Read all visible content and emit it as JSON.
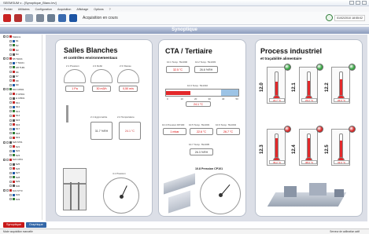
{
  "window": {
    "title": "SEEMSUM v - [Synoptique_Blanc.lev]"
  },
  "menu": [
    "Fichier",
    "Utilitaires",
    "Configuration",
    "Acquisition",
    "Affichage",
    "Options",
    "?"
  ],
  "toolbar": {
    "status": "Acquisition en cours",
    "datetime": "01/02/2010 18:55:02"
  },
  "header": {
    "title": "Synoptique"
  },
  "tree": [
    "Stations",
    "N1",
    "N2",
    "N3",
    "N4",
    "N5 TH101",
    "T TH101",
    "HR TH01",
    "N6",
    "N7",
    "N8",
    "N9",
    "N10 CP301",
    "P CP301",
    "H CP301",
    "N11",
    "N12",
    "N13",
    "N14",
    "N15",
    "N16",
    "N17",
    "N18",
    "N19",
    "N20 ST01",
    "N21",
    "N22",
    "N23",
    "N24 CP01",
    "N25",
    "N26",
    "N27",
    "N28",
    "N29",
    "N30",
    "N31 ST73",
    "N32",
    "N33"
  ],
  "panels": {
    "salles": {
      "title": "Salles Blanches",
      "subtitle": "et contrôles environnementaux",
      "labels": [
        "2.1 Pression",
        "2.2 Débit",
        "2.3 Vitesse",
        "2.1 Hygrométrie",
        "2.2 Température",
        "4.1 Pression"
      ],
      "values": [
        "1 Pa",
        "30 m3/h",
        "0,50 m/s",
        "31.7 %RH",
        "24.1 °C"
      ]
    },
    "cta": {
      "title": "CTA / Tertiaire",
      "labels": [
        "10.1 Temp. TE1000",
        "10.2 Temp. TE1003",
        "10.3 Temp. TE1010",
        "10.4 Pression DP100",
        "10.5 Temp. TE1003",
        "10.6 Temp. TE1004",
        "10.7 Temp. TE1005",
        "10.8 Pression CP101"
      ],
      "values": [
        "32.5 °C",
        "26.6 %RH",
        "24.1 °C",
        "1 mbar",
        "22.6 °C",
        "26.7 °C",
        "26.3 %RH"
      ],
      "bar_ticks": [
        "0",
        "10",
        "20",
        "30",
        "40",
        "50"
      ],
      "bar_level": 0.48
    },
    "process": {
      "title": "Process industriel",
      "subtitle": "et traçabilité alimentaire",
      "thermos": [
        {
          "name": "12.0",
          "value": "22.7 °C",
          "level": 0.6,
          "led": "#3aa845"
        },
        {
          "name": "12.1",
          "value": "23.2 °C",
          "level": 0.62,
          "led": "#3aa845"
        },
        {
          "name": "12.2",
          "value": "26.6 °C",
          "level": 0.7,
          "led": "#3aa845"
        },
        {
          "name": "12.3",
          "value": "39.2 °C",
          "level": 0.85,
          "led": "#d82828"
        },
        {
          "name": "12.4",
          "value": "38.6 °C",
          "level": 0.83,
          "led": "#d82828"
        },
        {
          "name": "12.5",
          "value": "33.6 °C",
          "level": 0.75,
          "led": "#d82828"
        }
      ]
    }
  },
  "tabs": [
    "Synoptique",
    "Graphique"
  ],
  "statusbar": {
    "left": "Mode acquisition manuelle",
    "right": "Serveur de calibration actif"
  }
}
